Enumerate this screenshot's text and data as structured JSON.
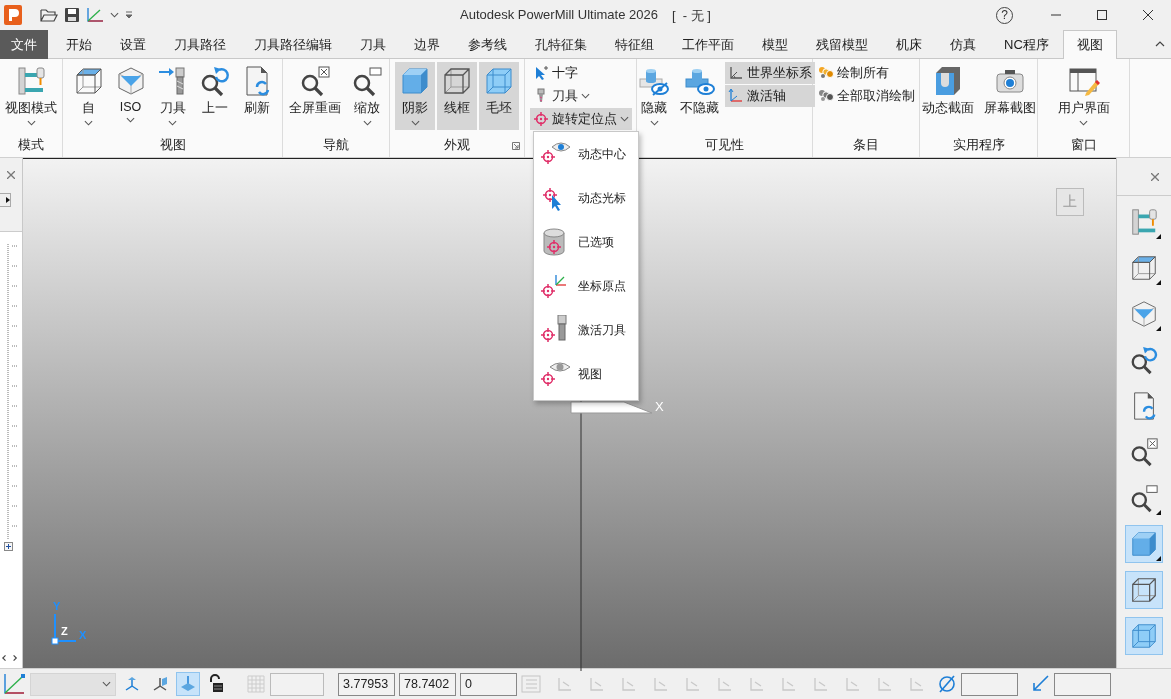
{
  "window": {
    "title": "Autodesk PowerMill Ultimate 2026",
    "project": "[  - 无 ]",
    "help": "?"
  },
  "tabs": [
    {
      "label": "文件",
      "kind": "file",
      "selected": false
    },
    {
      "label": "开始",
      "kind": "tab",
      "selected": false
    },
    {
      "label": "设置",
      "kind": "tab",
      "selected": false
    },
    {
      "label": "刀具路径",
      "kind": "tab",
      "selected": false
    },
    {
      "label": "刀具路径编辑",
      "kind": "tab",
      "selected": false
    },
    {
      "label": "刀具",
      "kind": "tab",
      "selected": false
    },
    {
      "label": "边界",
      "kind": "tab",
      "selected": false
    },
    {
      "label": "参考线",
      "kind": "tab",
      "selected": false
    },
    {
      "label": "孔特征集",
      "kind": "tab",
      "selected": false
    },
    {
      "label": "特征组",
      "kind": "tab",
      "selected": false
    },
    {
      "label": "工作平面",
      "kind": "tab",
      "selected": false
    },
    {
      "label": "模型",
      "kind": "tab",
      "selected": false
    },
    {
      "label": "残留模型",
      "kind": "tab",
      "selected": false
    },
    {
      "label": "机床",
      "kind": "tab",
      "selected": false
    },
    {
      "label": "仿真",
      "kind": "tab",
      "selected": false
    },
    {
      "label": "NC程序",
      "kind": "tab",
      "selected": false
    },
    {
      "label": "视图",
      "kind": "tab",
      "selected": true
    }
  ],
  "ribbon": {
    "groups": [
      {
        "label": "模式",
        "buttons": [
          {
            "label": "视图模式",
            "kind": "large",
            "dropdown": true,
            "pressed": false
          }
        ]
      },
      {
        "label": "视图",
        "buttons": [
          {
            "label": "自",
            "kind": "large",
            "dropdown": true,
            "pressed": false
          },
          {
            "label": "ISO",
            "kind": "large",
            "dropdown": true,
            "pressed": false
          },
          {
            "label": "刀具",
            "kind": "large",
            "dropdown": true,
            "pressed": false
          },
          {
            "label": "上一",
            "kind": "large",
            "dropdown": false,
            "pressed": false
          },
          {
            "label": "刷新",
            "kind": "large",
            "dropdown": false,
            "pressed": false
          }
        ]
      },
      {
        "label": "导航",
        "buttons": [
          {
            "label": "全屏重画",
            "kind": "large",
            "dropdown": false,
            "pressed": false
          },
          {
            "label": "缩放",
            "kind": "large",
            "dropdown": true,
            "pressed": false
          }
        ]
      },
      {
        "label": "外观",
        "launcher": true,
        "buttons": [
          {
            "label": "阴影",
            "kind": "large",
            "dropdown": true,
            "pressed": true
          },
          {
            "label": "线框",
            "kind": "large",
            "dropdown": false,
            "pressed": true
          },
          {
            "label": "毛坯",
            "kind": "large",
            "dropdown": false,
            "pressed": true
          }
        ]
      },
      {
        "buttons": [
          {
            "label": "十字",
            "kind": "small",
            "dropdown": false,
            "pressed": false
          },
          {
            "label": "刀具",
            "kind": "small",
            "dropdown": true,
            "pressed": false
          },
          {
            "label": "旋转定位点",
            "kind": "small",
            "dropdown": true,
            "pressed": true
          }
        ]
      },
      {
        "label": "可见性",
        "buttons": [
          {
            "label": "隐藏",
            "kind": "large",
            "dropdown": true,
            "pressed": false
          },
          {
            "label": "不隐藏",
            "kind": "large",
            "dropdown": false,
            "pressed": false
          },
          {
            "label": "世界坐标系",
            "kind": "small",
            "dropdown": false,
            "pressed": true
          },
          {
            "label": "激活轴",
            "kind": "small",
            "dropdown": false,
            "pressed": true
          }
        ]
      },
      {
        "label": "条目",
        "buttons": [
          {
            "label": "绘制所有",
            "kind": "small",
            "dropdown": false,
            "pressed": false
          },
          {
            "label": "全部取消绘制",
            "kind": "small",
            "dropdown": false,
            "pressed": false
          }
        ]
      },
      {
        "label": "实用程序",
        "buttons": [
          {
            "label": "动态截面",
            "kind": "large",
            "dropdown": false,
            "pressed": false
          },
          {
            "label": "屏幕截图",
            "kind": "large",
            "dropdown": false,
            "pressed": false
          }
        ]
      },
      {
        "label": "窗口",
        "buttons": [
          {
            "label": "用户界面",
            "kind": "large",
            "dropdown": true,
            "pressed": false
          }
        ]
      }
    ]
  },
  "menu": {
    "items": [
      {
        "label": "动态中心"
      },
      {
        "label": "动态光标"
      },
      {
        "label": "已选项"
      },
      {
        "label": "坐标原点"
      },
      {
        "label": "激活刀具"
      },
      {
        "label": "视图"
      }
    ]
  },
  "viewport": {
    "view_cube": "上",
    "axis_label": "X",
    "triad": {
      "y": "Y",
      "z": "Z",
      "x": "X"
    }
  },
  "right_toolbar": [
    {
      "selected": false,
      "dropdown": true
    },
    {
      "selected": false,
      "dropdown": true
    },
    {
      "selected": false,
      "dropdown": true
    },
    {
      "selected": false,
      "dropdown": false
    },
    {
      "selected": false,
      "dropdown": false
    },
    {
      "selected": false,
      "dropdown": false
    },
    {
      "selected": false,
      "dropdown": true
    },
    {
      "selected": true,
      "dropdown": true
    },
    {
      "selected": true,
      "dropdown": false
    },
    {
      "selected": true,
      "dropdown": false
    }
  ],
  "status_bar": {
    "toggles": [
      {
        "selected": false
      },
      {
        "selected": false
      },
      {
        "selected": true
      },
      {
        "selected": false
      }
    ],
    "fields": [
      {
        "value": "3.77953"
      },
      {
        "value": "78.7402"
      },
      {
        "value": "0"
      }
    ]
  }
}
